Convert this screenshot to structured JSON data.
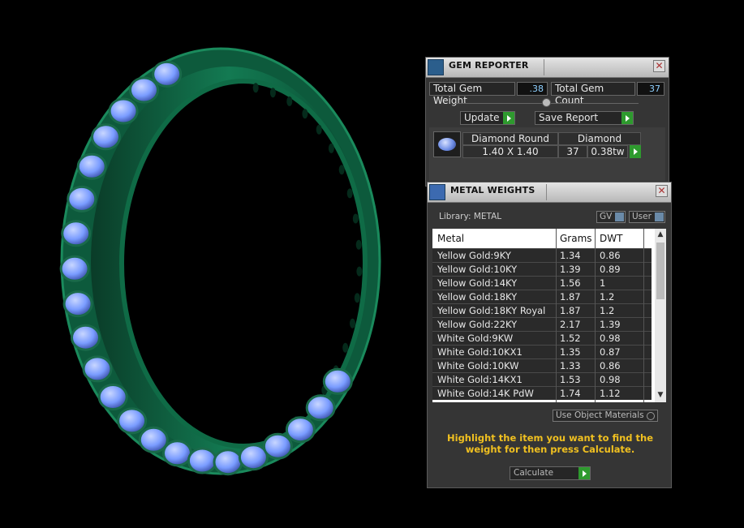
{
  "gem_reporter": {
    "title": "GEM REPORTER",
    "total_gem_weight_label": "Total Gem Weight",
    "total_gem_weight_value": ".38",
    "total_gem_count_label": "Total Gem Count",
    "total_gem_count_value": "37",
    "update_label": "Update",
    "save_report_label": "Save Report",
    "gem": {
      "shape": "Diamond Round",
      "material": "Diamond",
      "size": "1.40 X 1.40",
      "count": "37",
      "weight": "0.38tw"
    }
  },
  "metal_weights": {
    "title": "METAL WEIGHTS",
    "library_label": "Library: METAL",
    "gv_label": "GV",
    "user_label": "User",
    "columns": [
      "Metal",
      "Grams",
      "DWT"
    ],
    "rows": [
      [
        "Yellow Gold:9KY",
        "1.34",
        "0.86"
      ],
      [
        "Yellow Gold:10KY",
        "1.39",
        "0.89"
      ],
      [
        "Yellow Gold:14KY",
        "1.56",
        "1"
      ],
      [
        "Yellow Gold:18KY",
        "1.87",
        "1.2"
      ],
      [
        "Yellow Gold:18KY Royal",
        "1.87",
        "1.2"
      ],
      [
        "Yellow Gold:22KY",
        "2.17",
        "1.39"
      ],
      [
        "White Gold:9KW",
        "1.52",
        "0.98"
      ],
      [
        "White Gold:10KX1",
        "1.35",
        "0.87"
      ],
      [
        "White Gold:10KW",
        "1.33",
        "0.86"
      ],
      [
        "White Gold:14KX1",
        "1.53",
        "0.98"
      ],
      [
        "White Gold:14K PdW",
        "1.74",
        "1.12"
      ]
    ],
    "use_object_materials_label": "Use Object Materials",
    "hint": "Highlight the item you want to find the weight for then press Calculate.",
    "calculate_label": "Calculate"
  },
  "colors": {
    "ring_green": "#0d5a3c",
    "gem_blue": "#7a9cff",
    "hint_yellow": "#f0c020",
    "play_green": "#2e9a2e"
  }
}
